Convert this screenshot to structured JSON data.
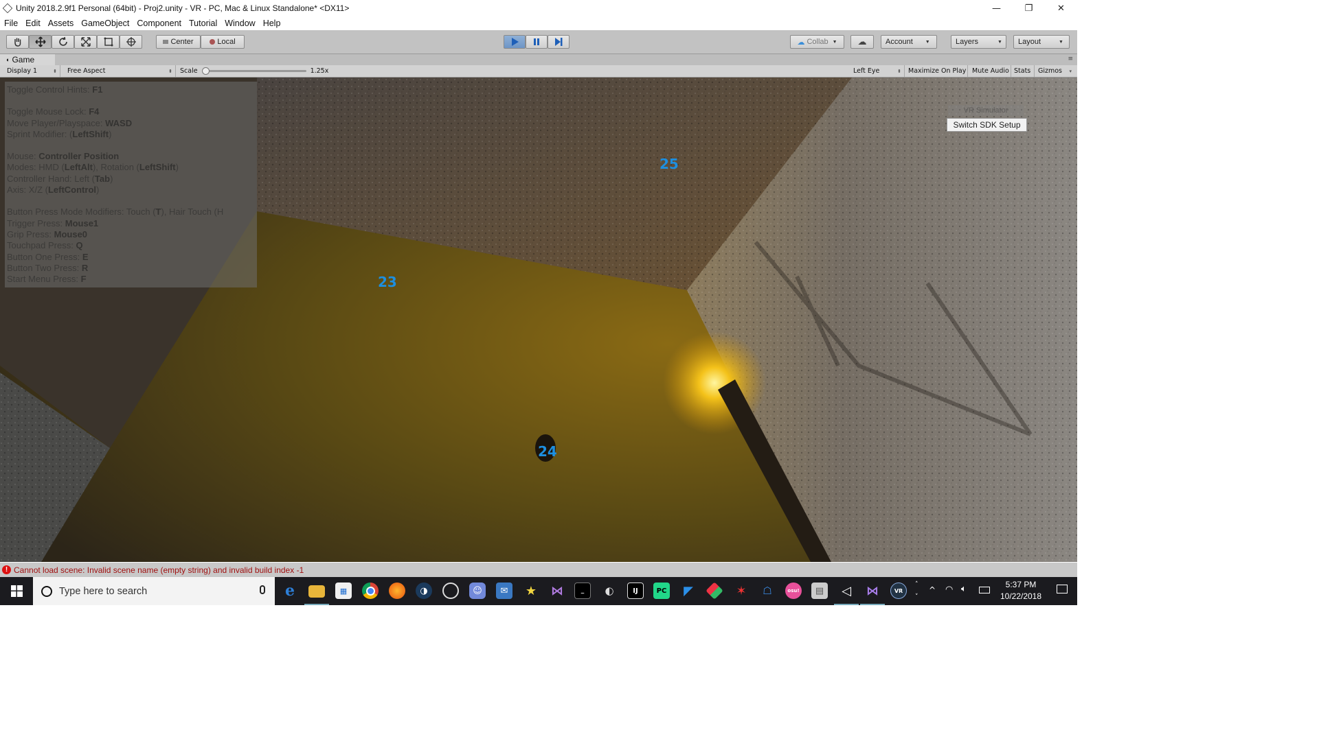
{
  "window": {
    "title": "Unity 2018.2.9f1 Personal (64bit) - Proj2.unity - VR - PC, Mac & Linux Standalone* <DX11>",
    "controls": {
      "minimize": "—",
      "restore": "❐",
      "close": "✕"
    }
  },
  "menu": [
    "File",
    "Edit",
    "Assets",
    "GameObject",
    "Component",
    "Tutorial",
    "Window",
    "Help"
  ],
  "toolbar": {
    "tools": [
      "hand-icon",
      "move-icon",
      "rotate-icon",
      "scale-icon",
      "rect-icon",
      "transform-icon"
    ],
    "pivot_label": "Center",
    "space_label": "Local",
    "play_state": "playing",
    "collab_label": "Collab",
    "account_label": "Account",
    "layers_label": "Layers",
    "layout_label": "Layout"
  },
  "game_view": {
    "tab_label": "Game",
    "display": "Display 1",
    "aspect": "Free Aspect",
    "scale_label": "Scale",
    "scale_value": "1.25x",
    "eye": "Left Eye",
    "maximize_on_play": "Maximize On Play",
    "mute_audio": "Mute Audio",
    "stats": "Stats",
    "gizmos": "Gizmos"
  },
  "hints": {
    "line1_text": "Toggle Control Hints: ",
    "line1_key": "F1",
    "line2_text": "Toggle Mouse Lock: ",
    "line2_key": "F4",
    "line3_text": "Move Player/Playspace: ",
    "line3_key": "WASD",
    "line4_text": "Sprint Modifier: (",
    "line4_key": "LeftShift",
    "line4_end": ")",
    "line5_text": "Mouse: ",
    "line5_key": "Controller Position",
    "line6_text": "Modes: HMD (",
    "line6_key": "LeftAlt",
    "line6_mid": "), Rotation (",
    "line6_key2": "LeftShift",
    "line6_end": ")",
    "line7_text": "Controller Hand: Left (",
    "line7_key": "Tab",
    "line7_end": ")",
    "line8_text": "Axis: X/Z (",
    "line8_key": "LeftControl",
    "line8_end": ")",
    "line9_text": "Button Press Mode Modifiers: Touch (",
    "line9_key": "T",
    "line9_mid": "), Hair Touch (H",
    "line10_text": "Trigger Press: ",
    "line10_key": "Mouse1",
    "line11_text": "Grip Press: ",
    "line11_key": "Mouse0",
    "line12_text": "Touchpad Press: ",
    "line12_key": "Q",
    "line13_text": "Button One Press: ",
    "line13_key": "E",
    "line14_text": "Button Two Press: ",
    "line14_key": "R",
    "line15_text": "Start Menu Press: ",
    "line15_key": "F"
  },
  "markers": [
    "25",
    "23",
    "24"
  ],
  "sdk": {
    "title": "VR Simulator",
    "button": "Switch SDK Setup"
  },
  "status": {
    "message": "Cannot load scene: Invalid scene name (empty string) and invalid build index -1"
  },
  "taskbar": {
    "search_placeholder": "Type here to search",
    "time": "5:37 PM",
    "date": "10/22/2018"
  },
  "colors": {
    "marker": "#1d8fe0",
    "error": "#a01010",
    "play_active": "#6e95c6"
  }
}
